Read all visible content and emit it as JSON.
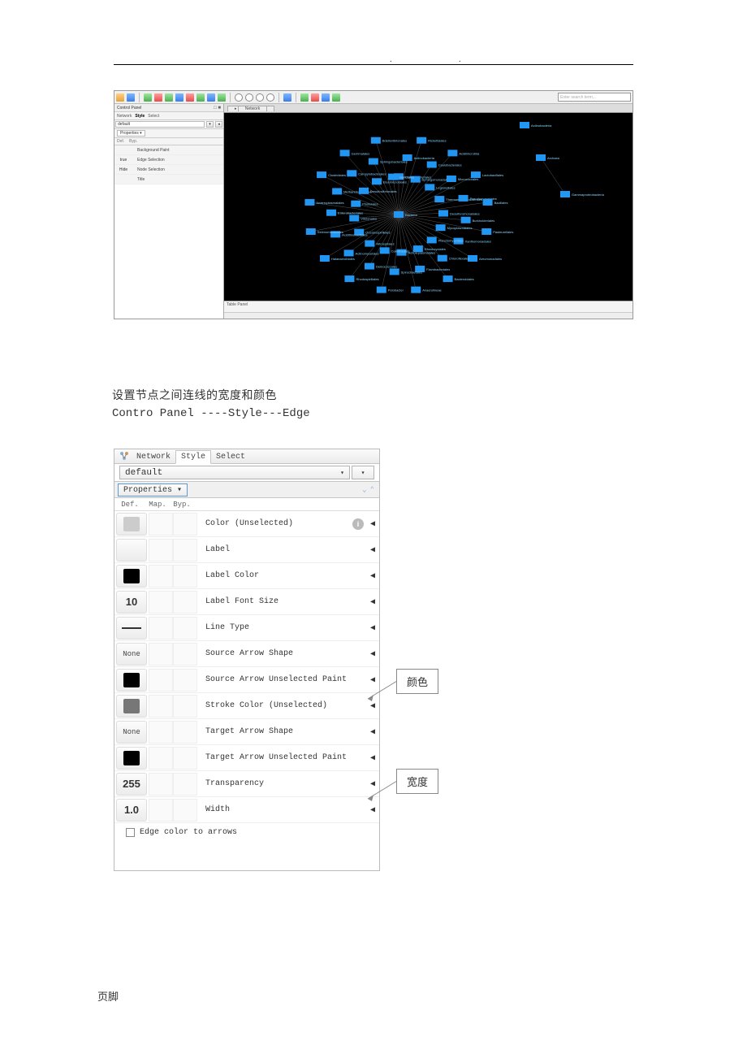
{
  "header": {
    "dots": ". ."
  },
  "app1": {
    "control_panel_title": "Control Panel",
    "minmax": "□ ■",
    "tabs": {
      "network": "Network",
      "style": "Style",
      "select": "Select"
    },
    "style_value": "default",
    "properties_label": "Properties ▾",
    "subtabs": {
      "def": "Def.",
      "byp": "Byp."
    },
    "rows": [
      {
        "def": "swatch",
        "label": "Background Paint"
      },
      {
        "def": "text",
        "def_text": "true",
        "label": "Edge Selection"
      },
      {
        "def": "text",
        "def_text": "Hide",
        "label": "Node Selection"
      },
      {
        "def": "blank",
        "label": "Title"
      }
    ],
    "search_placeholder": "Enter search term...",
    "network_tab": "Network",
    "table_panel": "Table Panel",
    "graph_nodes": [
      "Corynebacteriales",
      "Actinobacteria",
      "Rickettsiales",
      "Sphingomonadales",
      "Caulobacterales",
      "Acidimicrobiia",
      "Legionellales",
      "Micrococcales",
      "Lactobacillales",
      "Thermoanaerobacterales",
      "Pseudomonadales",
      "Bacillales",
      "Desulfuromonadales",
      "Burkholderiales",
      "Pasteurellales",
      "Mycoplasmatales",
      "Xanthomonadales",
      "Aeromonadales",
      "Planctomycetales",
      "Chloroflexales",
      "Bacteroidales",
      "Rhodocyclales",
      "Flavobacteriales",
      "Anaerolineae",
      "Acholeplasmatales",
      "Spirochaetales",
      "Pelobacter",
      "Caldilineales",
      "Deinococcales",
      "Rhodospirillales",
      "Nitrospirales",
      "Actinomycetales",
      "Halanaerobiales",
      "Oceanospirillales",
      "Acidithiobacillales",
      "Selenomonadales",
      "Vibrionales",
      "Enterobacteriales",
      "Anaeroplasmatales",
      "Pirellulales",
      "Methanobacteriales",
      "Clostridiales",
      "Desulfovibrionales",
      "Campylobacterales",
      "Gemmatales",
      "Elusimicrobiales",
      "Sphingobacteriales",
      "Bdellovibrionales",
      "Opitutales",
      "Bacteria",
      "Archaea",
      "Gammaproteobacteria"
    ]
  },
  "text": {
    "para1": "设置节点之间连线的宽度和颜色",
    "para2": "Contro Panel ----Style---Edge"
  },
  "panel2": {
    "tabs": {
      "network": "Network",
      "style": "Style",
      "select": "Select"
    },
    "style_value": "default",
    "properties_label": "Properties ▾",
    "header": {
      "def": "Def.",
      "map": "Map.",
      "byp": "Byp."
    },
    "rows": [
      {
        "def_type": "light",
        "label": "Color (Unselected)",
        "info": true
      },
      {
        "def_type": "blank",
        "label": "Label"
      },
      {
        "def_type": "black",
        "label": "Label Color"
      },
      {
        "def_type": "num",
        "def_val": "10",
        "label": "Label Font Size"
      },
      {
        "def_type": "line",
        "label": "Line Type"
      },
      {
        "def_type": "text",
        "def_val": "None",
        "label": "Source Arrow Shape"
      },
      {
        "def_type": "black",
        "label": "Source Arrow Unselected Paint"
      },
      {
        "def_type": "gray",
        "label": "Stroke Color (Unselected)"
      },
      {
        "def_type": "text",
        "def_val": "None",
        "label": "Target Arrow Shape"
      },
      {
        "def_type": "black",
        "label": "Target Arrow Unselected Paint"
      },
      {
        "def_type": "num",
        "def_val": "255",
        "label": "Transparency"
      },
      {
        "def_type": "num",
        "def_val": "1.0",
        "label": "Width"
      }
    ],
    "checkbox_label": "Edge color to arrows"
  },
  "callouts": {
    "color": "颜色",
    "width": "宽度"
  },
  "footer": "页脚"
}
